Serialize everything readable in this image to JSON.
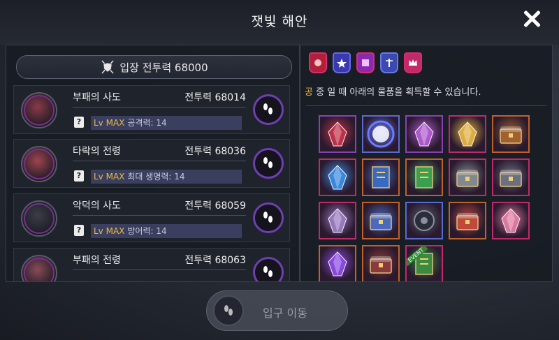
{
  "title": "잿빛 해안",
  "entry_requirement": "입장 전투력 68000",
  "dungeons": [
    {
      "name": "부패의 사도",
      "power": "전투력 68014",
      "lv": "Lv MAX",
      "stat": "공격력: 14",
      "color": "#8a3a4a"
    },
    {
      "name": "타락의 전령",
      "power": "전투력 68036",
      "lv": "Lv MAX",
      "stat": "최대 생명력: 14",
      "color": "#a04450"
    },
    {
      "name": "악덕의 사도",
      "power": "전투력 68059",
      "lv": "Lv MAX",
      "stat": "방어력: 14",
      "color": "#3a3e48"
    },
    {
      "name": "부패의 전령",
      "power": "전투력 68063",
      "lv": "",
      "stat": "",
      "color": "#8a4a58"
    }
  ],
  "reward_notice": "중 일 때 아래의 물품을 획득할 수 있습니다.",
  "reward_notice_prefix": "공",
  "items": [
    {
      "icon": "red-gem-icon",
      "color": "#c0324a",
      "border": "#8b3fb6"
    },
    {
      "icon": "blue-orb-icon",
      "color": "#6a7cff",
      "border": "#5a6ad0"
    },
    {
      "icon": "purple-crystal-icon",
      "color": "#b05ad0",
      "border": "#8b3fb6"
    },
    {
      "icon": "gold-gem-icon",
      "color": "#e0b040",
      "border": "#c02a6a"
    },
    {
      "icon": "chest-icon",
      "color": "#a06030",
      "border": "#c0602a"
    },
    {
      "icon": "blue-crystal-icon",
      "color": "#3a8ae0",
      "border": "#c02a6a"
    },
    {
      "icon": "scroll-icon",
      "color": "#3a6ac0",
      "border": "#c0602a"
    },
    {
      "icon": "green-scroll-icon",
      "color": "#3aa050",
      "border": "#c0602a"
    },
    {
      "icon": "ornate-chest-icon",
      "color": "#808890",
      "border": "#c02a6a"
    },
    {
      "icon": "silver-chest-icon",
      "color": "#6a7080",
      "border": "#c02a6a"
    },
    {
      "icon": "crystal-cluster-icon",
      "color": "#9a7ac0",
      "border": "#c02a6a"
    },
    {
      "icon": "treasure-box-icon",
      "color": "#4a6ac0",
      "border": "#c0602a"
    },
    {
      "icon": "wheel-icon",
      "color": "#5a6070",
      "border": "#5a6ad0"
    },
    {
      "icon": "red-chest-icon",
      "color": "#c04a3a",
      "border": "#c0602a"
    },
    {
      "icon": "pink-crystal-icon",
      "color": "#e07aa0",
      "border": "#c02a6a"
    },
    {
      "icon": "amethyst-icon",
      "color": "#8a4ae0",
      "border": "#c0602a"
    },
    {
      "icon": "dark-chest-icon",
      "color": "#8a3a3a",
      "border": "#c0602a"
    },
    {
      "icon": "event-scroll-icon",
      "color": "#3a8a40",
      "border": "#c02a6a"
    }
  ],
  "event_label": "EVENT",
  "enter_button": "입구 이동"
}
